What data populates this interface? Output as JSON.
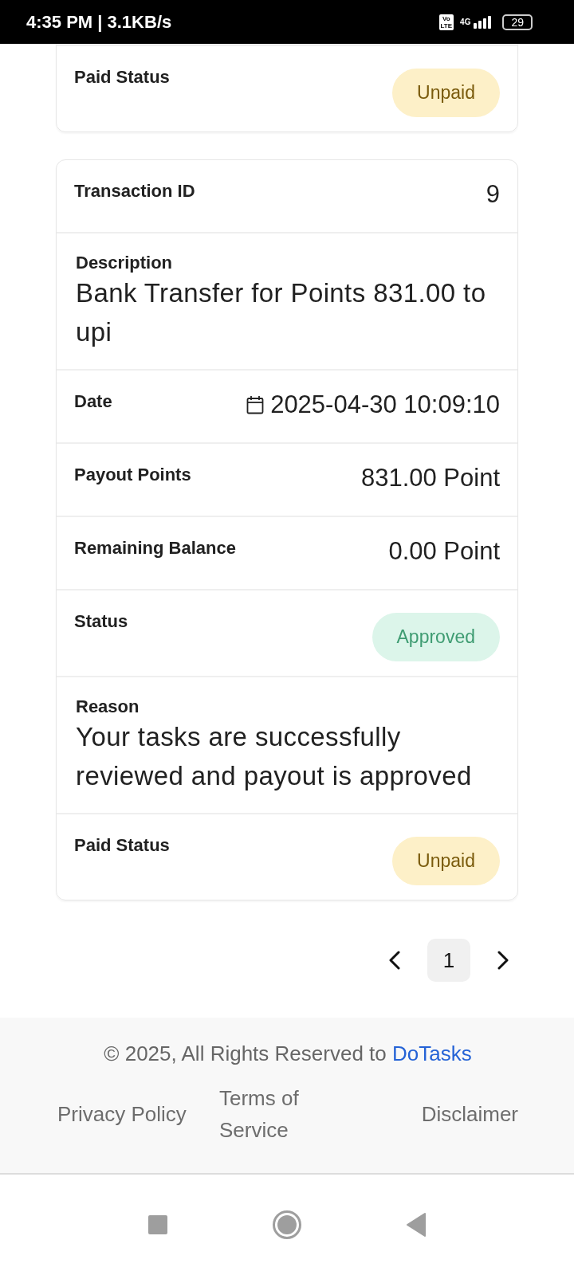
{
  "status_bar": {
    "time": "4:35 PM | 3.1KB/s",
    "volte_top": "Vo",
    "volte_bottom": "LTE",
    "network": "4G",
    "battery": "29"
  },
  "cards": [
    {
      "rows": [
        {
          "kind": "blank"
        },
        {
          "kind": "warningbadge",
          "label": "Paid Status",
          "value": "Unpaid"
        }
      ]
    },
    {
      "rows": [
        {
          "kind": "pair",
          "label": "Transaction ID",
          "value": "9"
        },
        {
          "kind": "text",
          "label": "Description",
          "text": "Bank Transfer for Points 831.00 to upi"
        },
        {
          "kind": "date",
          "label": "Date",
          "value": "2025-04-30 10:09:10"
        },
        {
          "kind": "pair",
          "label": "Payout Points",
          "value": "831.00 Point"
        },
        {
          "kind": "pair",
          "label": "Remaining Balance",
          "value": "0.00 Point"
        },
        {
          "kind": "successbadge",
          "label": "Status",
          "value": "Approved"
        },
        {
          "kind": "text",
          "label": "Reason",
          "text": "Your tasks are successfully reviewed and payout is approved"
        },
        {
          "kind": "warningbadge",
          "label": "Paid Status",
          "value": "Unpaid"
        }
      ]
    }
  ],
  "pagination": {
    "pages": [
      {
        "label": "1",
        "selected": true
      }
    ]
  },
  "footer": {
    "copyright": "© 2025, All Rights Reserved to",
    "brand": "DoTasks",
    "links": [
      "Privacy Policy",
      "Terms of Service",
      "Disclaimer"
    ]
  }
}
